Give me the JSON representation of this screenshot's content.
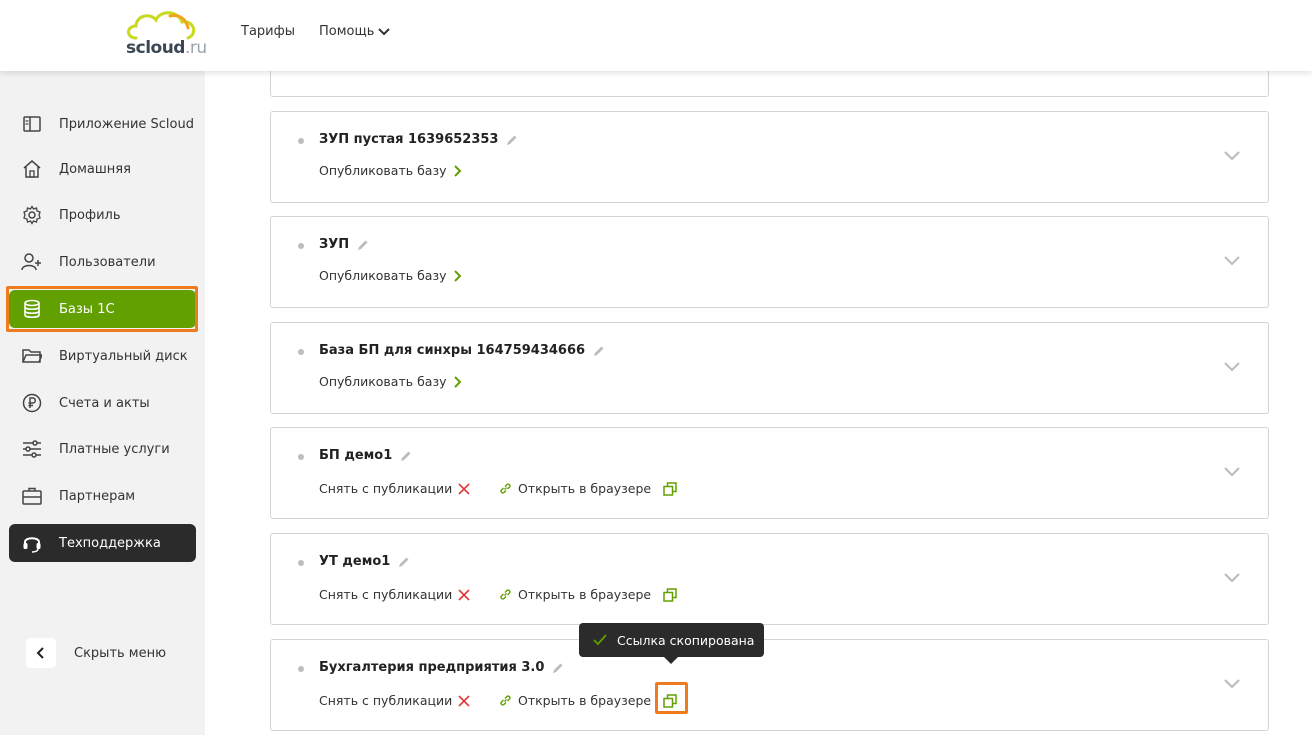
{
  "header": {
    "logo_main": "scloud",
    "logo_suffix": ".ru",
    "nav": {
      "tariffs": "Тарифы",
      "help": "Помощь"
    }
  },
  "sidebar": {
    "items": [
      {
        "label": "Приложение Scloud",
        "icon": "app-panel-icon"
      },
      {
        "label": "Домашняя",
        "icon": "home-icon"
      },
      {
        "label": "Профиль",
        "icon": "gear-icon"
      },
      {
        "label": "Пользователи",
        "icon": "user-add-icon"
      },
      {
        "label": "Базы 1С",
        "icon": "database-icon",
        "active": true
      },
      {
        "label": "Виртуальный диск",
        "icon": "folder-icon"
      },
      {
        "label": "Счета и акты",
        "icon": "ruble-icon"
      },
      {
        "label": "Платные услуги",
        "icon": "sliders-icon"
      },
      {
        "label": "Партнерам",
        "icon": "briefcase-icon"
      },
      {
        "label": "Техподдержка",
        "icon": "headset-icon",
        "dark": true
      }
    ],
    "hide_menu": "Скрыть меню"
  },
  "bases": [
    {
      "title": "ЗУП пустая 1639652353",
      "publish": "Опубликовать базу"
    },
    {
      "title": "ЗУП",
      "publish": "Опубликовать базу"
    },
    {
      "title": "База БП для синхры 164759434666",
      "publish": "Опубликовать базу"
    },
    {
      "title": "БП демо1",
      "unpublish": "Снять с публикации",
      "open": "Открыть в браузере"
    },
    {
      "title": "УТ демо1",
      "unpublish": "Снять с публикации",
      "open": "Открыть в браузере"
    },
    {
      "title": "Бухгалтерия предприятия 3.0",
      "unpublish": "Снять с публикации",
      "open": "Открыть в браузере"
    }
  ],
  "tooltip": {
    "text": "Ссылка скопирована"
  },
  "colors": {
    "accent": "#62a002",
    "highlight": "#f07b1e",
    "dark": "#2b2b2b",
    "remove": "#e03b3b"
  }
}
